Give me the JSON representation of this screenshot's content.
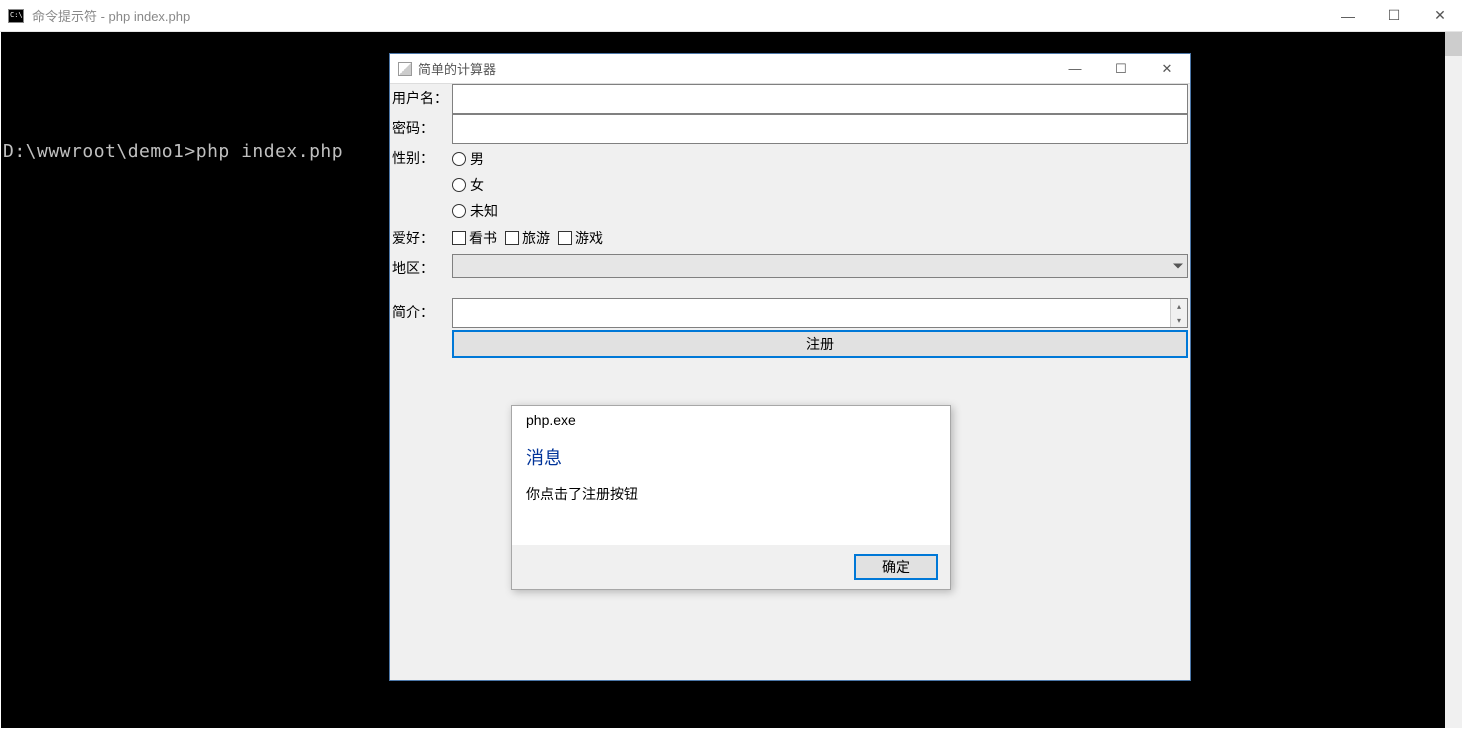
{
  "cmdWindow": {
    "title": "命令提示符 - php  index.php",
    "prompt": "D:\\wwwroot\\demo1>php index.php"
  },
  "appWindow": {
    "title": "简单的计算器",
    "form": {
      "username_label": "用户名：",
      "password_label": "密码：",
      "gender_label": "性别：",
      "gender_options": [
        "男",
        "女",
        "未知"
      ],
      "hobby_label": "爱好：",
      "hobby_options": [
        "看书",
        "旅游",
        "游戏"
      ],
      "region_label": "地区：",
      "bio_label": "简介：",
      "submit_label": "注册"
    }
  },
  "dialog": {
    "title": "php.exe",
    "heading": "消息",
    "message": "你点击了注册按钮",
    "ok_label": "确定"
  }
}
